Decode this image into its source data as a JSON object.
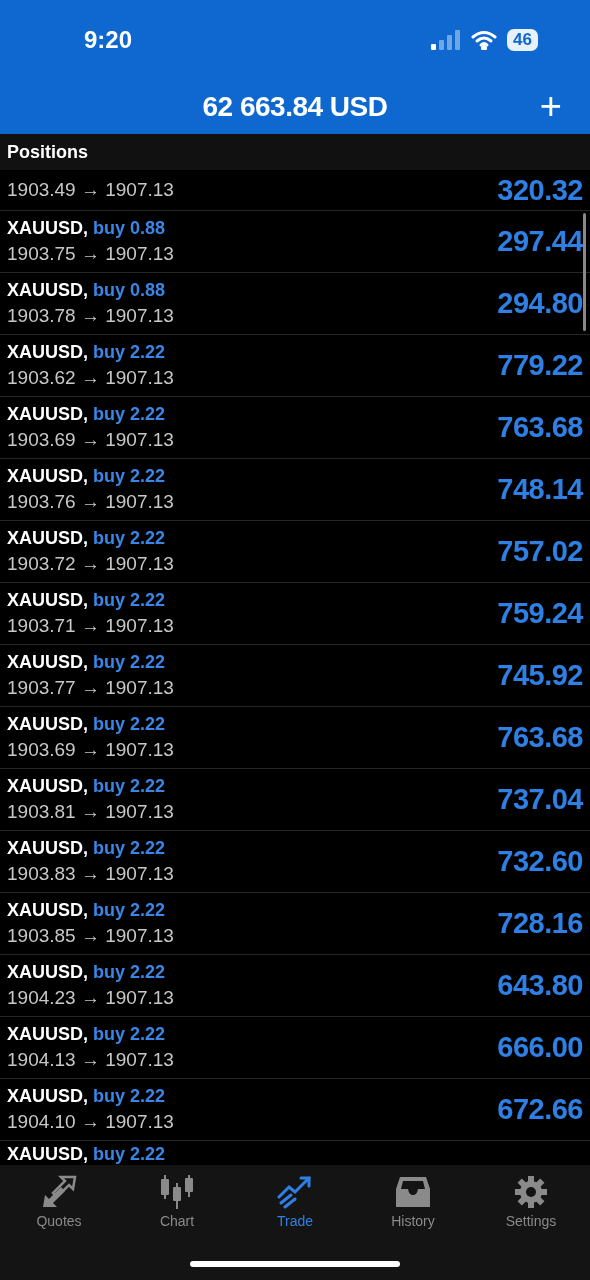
{
  "status_bar": {
    "time": "9:20",
    "battery": "46"
  },
  "header": {
    "title": "62 663.84 USD",
    "add": "+"
  },
  "section": {
    "title": "Positions"
  },
  "positions": [
    {
      "prices": "1903.49 → 1907.13",
      "profit": "320.32"
    },
    {
      "symbol": "XAUUSD,",
      "order": "buy 0.88",
      "prices": "1903.75 → 1907.13",
      "profit": "297.44"
    },
    {
      "symbol": "XAUUSD,",
      "order": "buy 0.88",
      "prices": "1903.78 → 1907.13",
      "profit": "294.80"
    },
    {
      "symbol": "XAUUSD,",
      "order": "buy 2.22",
      "prices": "1903.62 → 1907.13",
      "profit": "779.22"
    },
    {
      "symbol": "XAUUSD,",
      "order": "buy 2.22",
      "prices": "1903.69 → 1907.13",
      "profit": "763.68"
    },
    {
      "symbol": "XAUUSD,",
      "order": "buy 2.22",
      "prices": "1903.76 → 1907.13",
      "profit": "748.14"
    },
    {
      "symbol": "XAUUSD,",
      "order": "buy 2.22",
      "prices": "1903.72 → 1907.13",
      "profit": "757.02"
    },
    {
      "symbol": "XAUUSD,",
      "order": "buy 2.22",
      "prices": "1903.71 → 1907.13",
      "profit": "759.24"
    },
    {
      "symbol": "XAUUSD,",
      "order": "buy 2.22",
      "prices": "1903.77 → 1907.13",
      "profit": "745.92"
    },
    {
      "symbol": "XAUUSD,",
      "order": "buy 2.22",
      "prices": "1903.69 → 1907.13",
      "profit": "763.68"
    },
    {
      "symbol": "XAUUSD,",
      "order": "buy 2.22",
      "prices": "1903.81 → 1907.13",
      "profit": "737.04"
    },
    {
      "symbol": "XAUUSD,",
      "order": "buy 2.22",
      "prices": "1903.83 → 1907.13",
      "profit": "732.60"
    },
    {
      "symbol": "XAUUSD,",
      "order": "buy 2.22",
      "prices": "1903.85 → 1907.13",
      "profit": "728.16"
    },
    {
      "symbol": "XAUUSD,",
      "order": "buy 2.22",
      "prices": "1904.23 → 1907.13",
      "profit": "643.80"
    },
    {
      "symbol": "XAUUSD,",
      "order": "buy 2.22",
      "prices": "1904.13 → 1907.13",
      "profit": "666.00"
    },
    {
      "symbol": "XAUUSD,",
      "order": "buy 2.22",
      "prices": "1904.10 → 1907.13",
      "profit": "672.66"
    },
    {
      "symbol": "XAUUSD,",
      "order": "buy 2.22"
    }
  ],
  "tabs": [
    {
      "label": "Quotes",
      "kind": "quotes",
      "selected": false
    },
    {
      "label": "Chart",
      "kind": "chart",
      "selected": false
    },
    {
      "label": "Trade",
      "kind": "trade",
      "selected": true
    },
    {
      "label": "History",
      "kind": "history",
      "selected": false
    },
    {
      "label": "Settings",
      "kind": "settings",
      "selected": false
    }
  ]
}
